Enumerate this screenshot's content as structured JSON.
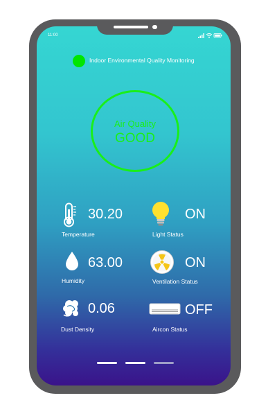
{
  "status_bar": {
    "time": "11:00"
  },
  "header": {
    "title": "Indoor Environmental Quality Monitoring",
    "indicator_color": "#00e600"
  },
  "air_quality": {
    "label": "Air Quality",
    "value": "GOOD",
    "color": "#1aef1a"
  },
  "sensors": {
    "temperature": {
      "value": "30.20",
      "label": "Temperature",
      "icon": "thermometer-icon"
    },
    "humidity": {
      "value": "63.00",
      "label": "Humidity",
      "icon": "water-drop-icon"
    },
    "dust": {
      "value": "0.06",
      "label": "Dust Density",
      "icon": "dust-cloud-icon"
    }
  },
  "devices": {
    "light": {
      "value": "ON",
      "label": "Light Status",
      "icon": "light-bulb-icon"
    },
    "ventilation": {
      "value": "ON",
      "label": "Ventilation Status",
      "icon": "fan-icon"
    },
    "aircon": {
      "value": "OFF",
      "label": "Aircon Status",
      "icon": "aircon-icon"
    }
  },
  "colors": {
    "gradient_top": "#35d6d2",
    "gradient_bottom": "#3a138a",
    "phone_frame": "#5a5a5c"
  }
}
